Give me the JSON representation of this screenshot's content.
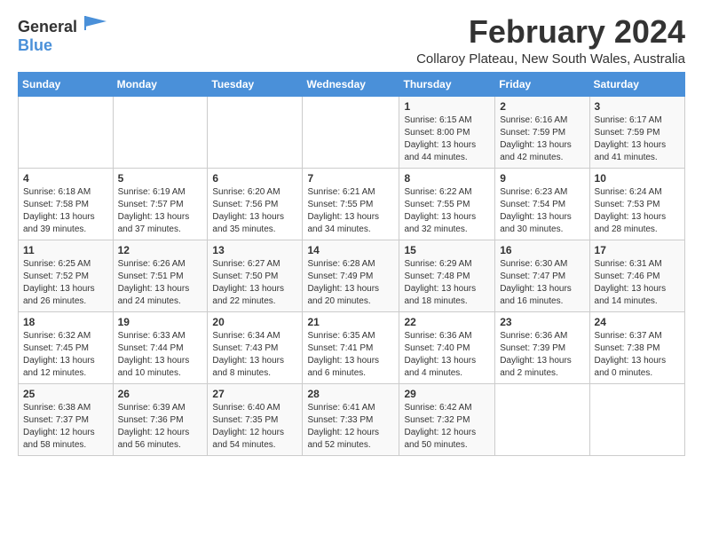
{
  "logo": {
    "general": "General",
    "blue": "Blue"
  },
  "title": "February 2024",
  "subtitle": "Collaroy Plateau, New South Wales, Australia",
  "days_of_week": [
    "Sunday",
    "Monday",
    "Tuesday",
    "Wednesday",
    "Thursday",
    "Friday",
    "Saturday"
  ],
  "weeks": [
    [
      {
        "day": "",
        "detail": ""
      },
      {
        "day": "",
        "detail": ""
      },
      {
        "day": "",
        "detail": ""
      },
      {
        "day": "",
        "detail": ""
      },
      {
        "day": "1",
        "detail": "Sunrise: 6:15 AM\nSunset: 8:00 PM\nDaylight: 13 hours\nand 44 minutes."
      },
      {
        "day": "2",
        "detail": "Sunrise: 6:16 AM\nSunset: 7:59 PM\nDaylight: 13 hours\nand 42 minutes."
      },
      {
        "day": "3",
        "detail": "Sunrise: 6:17 AM\nSunset: 7:59 PM\nDaylight: 13 hours\nand 41 minutes."
      }
    ],
    [
      {
        "day": "4",
        "detail": "Sunrise: 6:18 AM\nSunset: 7:58 PM\nDaylight: 13 hours\nand 39 minutes."
      },
      {
        "day": "5",
        "detail": "Sunrise: 6:19 AM\nSunset: 7:57 PM\nDaylight: 13 hours\nand 37 minutes."
      },
      {
        "day": "6",
        "detail": "Sunrise: 6:20 AM\nSunset: 7:56 PM\nDaylight: 13 hours\nand 35 minutes."
      },
      {
        "day": "7",
        "detail": "Sunrise: 6:21 AM\nSunset: 7:55 PM\nDaylight: 13 hours\nand 34 minutes."
      },
      {
        "day": "8",
        "detail": "Sunrise: 6:22 AM\nSunset: 7:55 PM\nDaylight: 13 hours\nand 32 minutes."
      },
      {
        "day": "9",
        "detail": "Sunrise: 6:23 AM\nSunset: 7:54 PM\nDaylight: 13 hours\nand 30 minutes."
      },
      {
        "day": "10",
        "detail": "Sunrise: 6:24 AM\nSunset: 7:53 PM\nDaylight: 13 hours\nand 28 minutes."
      }
    ],
    [
      {
        "day": "11",
        "detail": "Sunrise: 6:25 AM\nSunset: 7:52 PM\nDaylight: 13 hours\nand 26 minutes."
      },
      {
        "day": "12",
        "detail": "Sunrise: 6:26 AM\nSunset: 7:51 PM\nDaylight: 13 hours\nand 24 minutes."
      },
      {
        "day": "13",
        "detail": "Sunrise: 6:27 AM\nSunset: 7:50 PM\nDaylight: 13 hours\nand 22 minutes."
      },
      {
        "day": "14",
        "detail": "Sunrise: 6:28 AM\nSunset: 7:49 PM\nDaylight: 13 hours\nand 20 minutes."
      },
      {
        "day": "15",
        "detail": "Sunrise: 6:29 AM\nSunset: 7:48 PM\nDaylight: 13 hours\nand 18 minutes."
      },
      {
        "day": "16",
        "detail": "Sunrise: 6:30 AM\nSunset: 7:47 PM\nDaylight: 13 hours\nand 16 minutes."
      },
      {
        "day": "17",
        "detail": "Sunrise: 6:31 AM\nSunset: 7:46 PM\nDaylight: 13 hours\nand 14 minutes."
      }
    ],
    [
      {
        "day": "18",
        "detail": "Sunrise: 6:32 AM\nSunset: 7:45 PM\nDaylight: 13 hours\nand 12 minutes."
      },
      {
        "day": "19",
        "detail": "Sunrise: 6:33 AM\nSunset: 7:44 PM\nDaylight: 13 hours\nand 10 minutes."
      },
      {
        "day": "20",
        "detail": "Sunrise: 6:34 AM\nSunset: 7:43 PM\nDaylight: 13 hours\nand 8 minutes."
      },
      {
        "day": "21",
        "detail": "Sunrise: 6:35 AM\nSunset: 7:41 PM\nDaylight: 13 hours\nand 6 minutes."
      },
      {
        "day": "22",
        "detail": "Sunrise: 6:36 AM\nSunset: 7:40 PM\nDaylight: 13 hours\nand 4 minutes."
      },
      {
        "day": "23",
        "detail": "Sunrise: 6:36 AM\nSunset: 7:39 PM\nDaylight: 13 hours\nand 2 minutes."
      },
      {
        "day": "24",
        "detail": "Sunrise: 6:37 AM\nSunset: 7:38 PM\nDaylight: 13 hours\nand 0 minutes."
      }
    ],
    [
      {
        "day": "25",
        "detail": "Sunrise: 6:38 AM\nSunset: 7:37 PM\nDaylight: 12 hours\nand 58 minutes."
      },
      {
        "day": "26",
        "detail": "Sunrise: 6:39 AM\nSunset: 7:36 PM\nDaylight: 12 hours\nand 56 minutes."
      },
      {
        "day": "27",
        "detail": "Sunrise: 6:40 AM\nSunset: 7:35 PM\nDaylight: 12 hours\nand 54 minutes."
      },
      {
        "day": "28",
        "detail": "Sunrise: 6:41 AM\nSunset: 7:33 PM\nDaylight: 12 hours\nand 52 minutes."
      },
      {
        "day": "29",
        "detail": "Sunrise: 6:42 AM\nSunset: 7:32 PM\nDaylight: 12 hours\nand 50 minutes."
      },
      {
        "day": "",
        "detail": ""
      },
      {
        "day": "",
        "detail": ""
      }
    ]
  ]
}
